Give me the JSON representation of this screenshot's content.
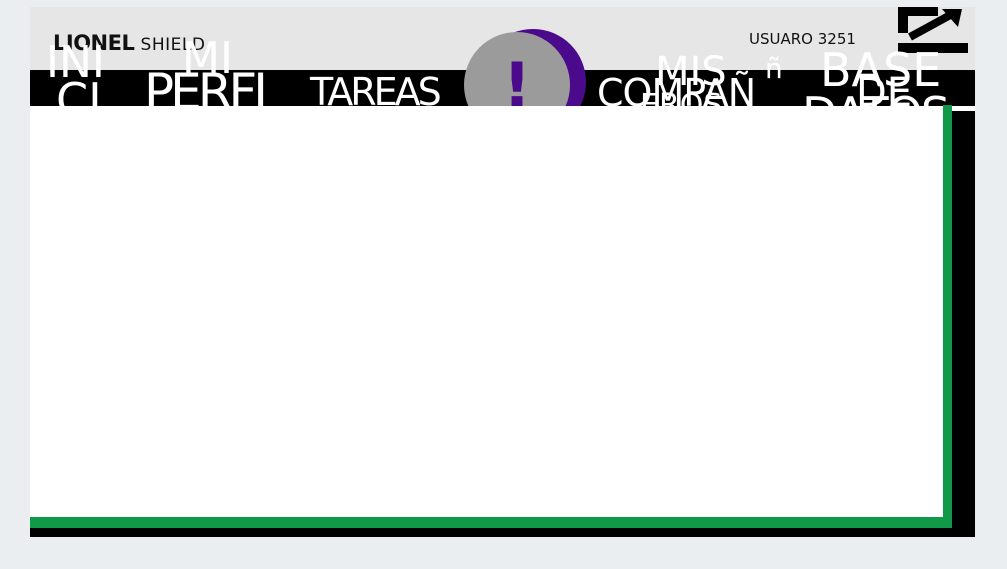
{
  "header": {
    "brand_bold": "LIONEL",
    "brand_light": "SHIELD",
    "user_label": "USUARO 3251",
    "logout_icon": "exit-arrow-icon"
  },
  "nav": {
    "items": [
      {
        "line1": "INI",
        "line2": "CI"
      },
      {
        "line1": "MI",
        "line2": "PERFI"
      },
      {
        "line1": "TAREAS",
        "line2": ""
      },
      {
        "line1": "COMPAÑ",
        "line2": "EROS"
      },
      {
        "line1": "MIS",
        "line2": ""
      },
      {
        "line1": "BASE",
        "line2": "DATOS"
      }
    ],
    "extra": [
      "ñ",
      "DE"
    ]
  },
  "alert": {
    "symbol": "!",
    "icon": "alert-exclamation-icon"
  },
  "colors": {
    "nav_bg": "#000000",
    "accent_green": "#11994a",
    "accent_purple": "#4b0a8c",
    "badge_gray": "#9b9b9b"
  }
}
